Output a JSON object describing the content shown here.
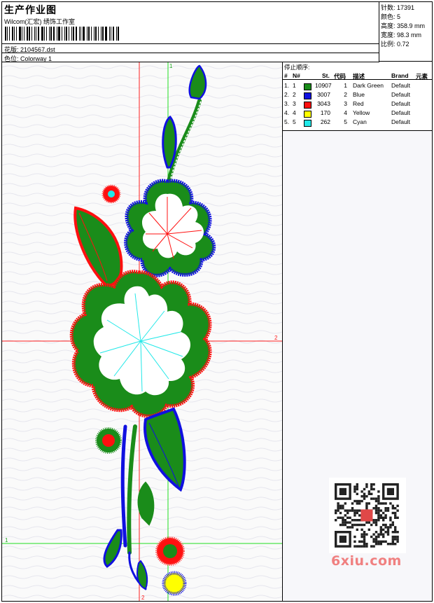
{
  "header": {
    "title": "生产作业图",
    "company": "Wilcom(汇宏) 绣饰工作室",
    "pattern_label": "花版:",
    "pattern_value": "2104567.dst",
    "colorway_label": "色位:",
    "colorway_value": "Colorway 1"
  },
  "stats": {
    "stitches_label": "针数:",
    "stitches_value": "17391",
    "colors_label": "颜色:",
    "colors_value": "5",
    "height_label": "高度:",
    "height_value": "358.9 mm",
    "width_label": "宽度:",
    "width_value": "98.3 mm",
    "scale_label": "比例:",
    "scale_value": "0.72"
  },
  "legend": {
    "title": "停止顺序:",
    "headers": {
      "num": "#",
      "n": "N#",
      "st": "St.",
      "code": "代码",
      "desc": "描述",
      "brand": "Brand",
      "elem": "元素"
    },
    "rows": [
      {
        "num": "1.",
        "n": "1",
        "color": "#1a8c1a",
        "st": "10907",
        "code": "1",
        "desc": "Dark Green",
        "brand": "Default"
      },
      {
        "num": "2.",
        "n": "2",
        "color": "#1010e0",
        "st": "3007",
        "code": "2",
        "desc": "Blue",
        "brand": "Default"
      },
      {
        "num": "3.",
        "n": "3",
        "color": "#ff1010",
        "st": "3043",
        "code": "3",
        "desc": "Red",
        "brand": "Default"
      },
      {
        "num": "4.",
        "n": "4",
        "color": "#ffff00",
        "st": "170",
        "code": "4",
        "desc": "Yellow",
        "brand": "Default"
      },
      {
        "num": "5.",
        "n": "5",
        "color": "#20e8e8",
        "st": "262",
        "code": "5",
        "desc": "Cyan",
        "brand": "Default"
      }
    ]
  },
  "guides": {
    "top_label": "1",
    "right_label": "2",
    "left_label": "1",
    "bottom_label": "2"
  },
  "watermark": "6xiu.com"
}
